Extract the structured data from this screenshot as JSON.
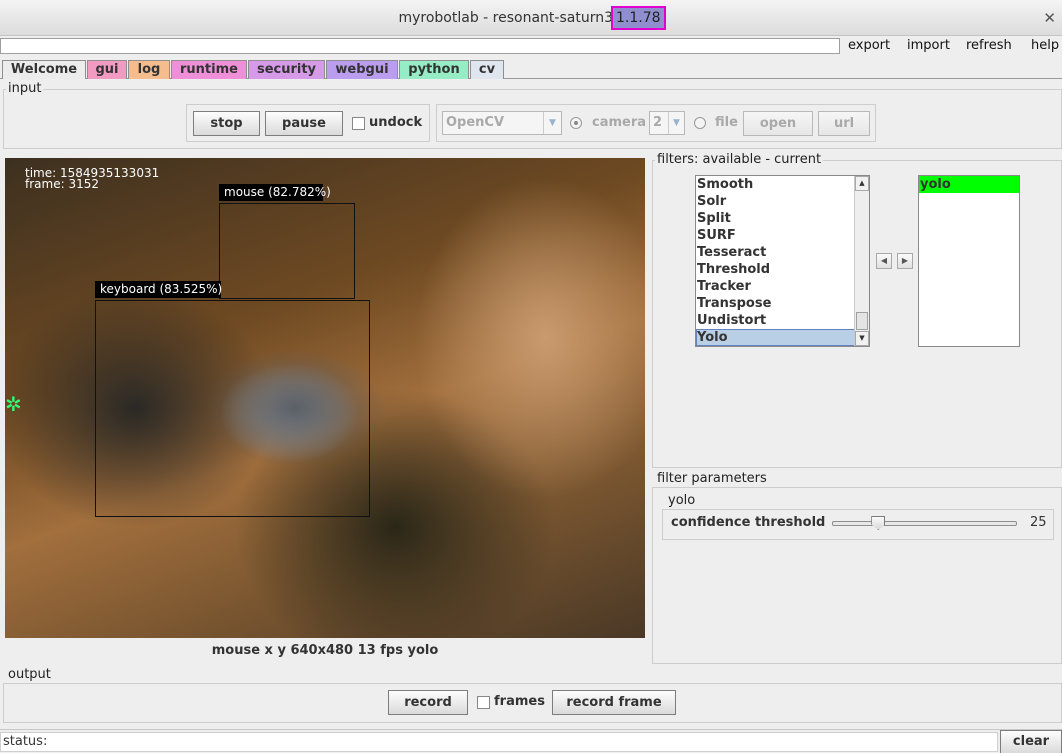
{
  "window": {
    "title": "myrobotlab - resonant-saturn3",
    "version": "1.1.78",
    "close": "✕"
  },
  "menu": {
    "export": "export",
    "import": "import",
    "refresh": "refresh",
    "help": "help"
  },
  "tabs": [
    {
      "label": "Welcome",
      "color": "#ececec"
    },
    {
      "label": "gui",
      "color": "#f39ac3"
    },
    {
      "label": "log",
      "color": "#f5bc8d"
    },
    {
      "label": "runtime",
      "color": "#ef8fd8"
    },
    {
      "label": "security",
      "color": "#d79ae9"
    },
    {
      "label": "webgui",
      "color": "#bb9df0"
    },
    {
      "label": "python",
      "color": "#96ecc4"
    },
    {
      "label": "cv",
      "color": "#dfe6ef"
    }
  ],
  "input": {
    "title": "input",
    "stop": "stop",
    "pause": "pause",
    "undock": "undock",
    "grabber": "OpenCV",
    "camera_label": "camera",
    "camera_index": "2",
    "file_label": "file",
    "open": "open",
    "url": "url"
  },
  "video": {
    "time": "time:  1584935133031",
    "frame": "frame: 3152",
    "detections": [
      {
        "label": "mouse (82.782%)"
      },
      {
        "label": "keyboard (83.525%)"
      }
    ],
    "status": "mouse x y 640x480 13 fps yolo"
  },
  "filters": {
    "title": "filters: available - current",
    "available": [
      "Smooth",
      "Solr",
      "Split",
      "SURF",
      "Tesseract",
      "Threshold",
      "Tracker",
      "Transpose",
      "Undistort",
      "Yolo"
    ],
    "selected_available": "Yolo",
    "current": [
      "yolo"
    ],
    "current_highlight": "#00ff00"
  },
  "parameters": {
    "title": "filter parameters",
    "filter_name": "yolo",
    "confidence_label": "confidence threshold",
    "confidence_value": "25",
    "confidence_fraction": 0.25
  },
  "output": {
    "title": "output",
    "record": "record",
    "frames": "frames",
    "record_frame": "record frame"
  },
  "status": {
    "label": "status:",
    "clear": "clear"
  }
}
